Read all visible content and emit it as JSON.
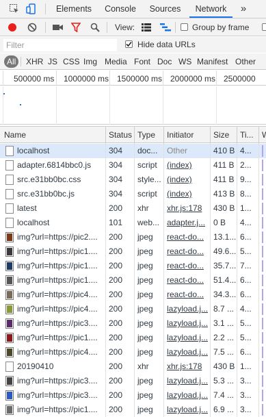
{
  "tabbar": {
    "tabs": [
      "Elements",
      "Console",
      "Sources",
      "Network"
    ],
    "active": "Network",
    "more": "»"
  },
  "toolbar": {
    "view_label": "View:",
    "group_by_frame": "Group by frame"
  },
  "filter": {
    "placeholder": "Filter",
    "hide_data_urls": "Hide data URLs",
    "hide_data_urls_checked": true
  },
  "types": [
    "All",
    "XHR",
    "JS",
    "CSS",
    "Img",
    "Media",
    "Font",
    "Doc",
    "WS",
    "Manifest",
    "Other"
  ],
  "active_type": "All",
  "timeline": {
    "ticks": [
      "500000 ms",
      "1000000 ms",
      "1500000 ms",
      "2000000 ms",
      "2500000 ms"
    ]
  },
  "table": {
    "columns": [
      "Name",
      "Status",
      "Type",
      "Initiator",
      "Size",
      "Ti...",
      "W"
    ],
    "rows": [
      {
        "name": "localhost",
        "status": "304",
        "type": "doc...",
        "initiator": "Other",
        "size": "410 B",
        "time": "4...",
        "icon": "doc",
        "selected": true
      },
      {
        "name": "adapter.6814bbc0.js",
        "status": "304",
        "type": "script",
        "initiator": "(index)",
        "size": "411 B",
        "time": "2...",
        "icon": "doc"
      },
      {
        "name": "src.e31bb0bc.css",
        "status": "304",
        "type": "style...",
        "initiator": "(index)",
        "size": "411 B",
        "time": "9...",
        "icon": "doc"
      },
      {
        "name": "src.e31bb0bc.js",
        "status": "304",
        "type": "script",
        "initiator": "(index)",
        "size": "413 B",
        "time": "8...",
        "icon": "doc"
      },
      {
        "name": "latest",
        "status": "200",
        "type": "xhr",
        "initiator": "xhr.js:178",
        "size": "430 B",
        "time": "1...",
        "icon": "doc"
      },
      {
        "name": "localhost",
        "status": "101",
        "type": "web...",
        "initiator": "adapter.j...",
        "size": "0 B",
        "time": "4...",
        "icon": "doc"
      },
      {
        "name": "img?url=https://pic2....",
        "status": "200",
        "type": "jpeg",
        "initiator": "react-do...",
        "size": "13.1...",
        "time": "6...",
        "icon": "img",
        "swatch": "#7a3a1a"
      },
      {
        "name": "img?url=https://pic1....",
        "status": "200",
        "type": "jpeg",
        "initiator": "react-do...",
        "size": "49.6...",
        "time": "5...",
        "icon": "img",
        "swatch": "#3a3a3a"
      },
      {
        "name": "img?url=https://pic1....",
        "status": "200",
        "type": "jpeg",
        "initiator": "react-do...",
        "size": "35.7...",
        "time": "7...",
        "icon": "img",
        "swatch": "#1d3b66"
      },
      {
        "name": "img?url=https://pic1....",
        "status": "200",
        "type": "jpeg",
        "initiator": "react-do...",
        "size": "51.4...",
        "time": "6...",
        "icon": "img",
        "swatch": "#555555"
      },
      {
        "name": "img?url=https://pic4....",
        "status": "200",
        "type": "jpeg",
        "initiator": "react-do...",
        "size": "34.3...",
        "time": "6...",
        "icon": "img",
        "swatch": "#7a6a5a"
      },
      {
        "name": "img?url=https://pic4....",
        "status": "200",
        "type": "jpeg",
        "initiator": "lazyload.j...",
        "size": "8.7 ...",
        "time": "4...",
        "icon": "img",
        "swatch": "#8a9a3a"
      },
      {
        "name": "img?url=https://pic3....",
        "status": "200",
        "type": "jpeg",
        "initiator": "lazyload.j...",
        "size": "3.1 ...",
        "time": "5...",
        "icon": "img",
        "swatch": "#5a2a6a"
      },
      {
        "name": "img?url=https://pic1....",
        "status": "200",
        "type": "jpeg",
        "initiator": "lazyload.j...",
        "size": "2.2 ...",
        "time": "5...",
        "icon": "img",
        "swatch": "#8a1a1a"
      },
      {
        "name": "img?url=https://pic4....",
        "status": "200",
        "type": "jpeg",
        "initiator": "lazyload.j...",
        "size": "7.5 ...",
        "time": "6...",
        "icon": "img",
        "swatch": "#4a4a2a"
      },
      {
        "name": "20190410",
        "status": "200",
        "type": "xhr",
        "initiator": "xhr.js:178",
        "size": "430 B",
        "time": "1...",
        "icon": "doc"
      },
      {
        "name": "img?url=https://pic3....",
        "status": "200",
        "type": "jpeg",
        "initiator": "lazyload.j...",
        "size": "5.3 ...",
        "time": "3...",
        "icon": "img",
        "swatch": "#444444"
      },
      {
        "name": "img?url=https://pic3....",
        "status": "200",
        "type": "jpeg",
        "initiator": "lazyload.j...",
        "size": "7.4 ...",
        "time": "3...",
        "icon": "img",
        "swatch": "#2a5abf"
      },
      {
        "name": "img?url=https://pic1....",
        "status": "200",
        "type": "jpeg",
        "initiator": "lazyload.j...",
        "size": "6.9 ...",
        "time": "3...",
        "icon": "img",
        "swatch": "#6a6a6a"
      }
    ]
  },
  "colors": {
    "accent": "#1a73e8",
    "record": "#e8201b",
    "filter_red": "#e8201b",
    "selected_row": "#dbe9fb",
    "waterfall": "#b4a4ef"
  }
}
